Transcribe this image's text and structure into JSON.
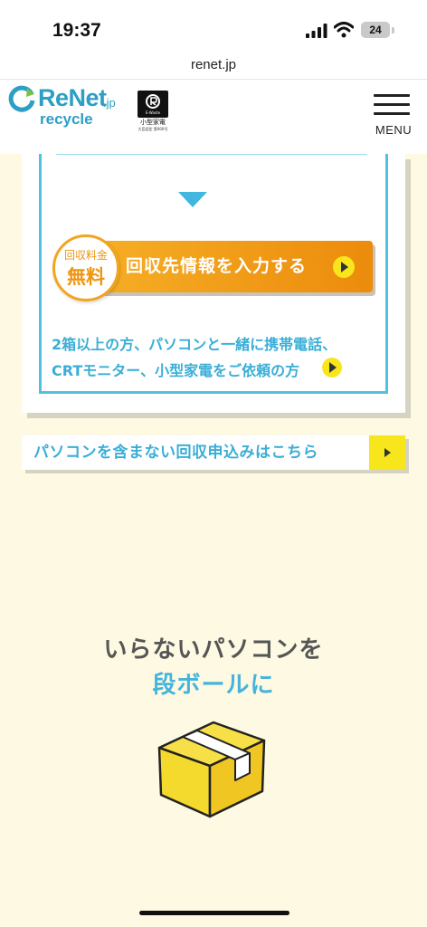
{
  "status_bar": {
    "time": "19:37",
    "battery": "24"
  },
  "browser": {
    "url": "renet.jp"
  },
  "header": {
    "logo_name": "ReNet",
    "logo_suffix": ".jp",
    "logo_sub": "recycle",
    "badge_label": "小型家電",
    "badge_tag": "E-Waste",
    "badge_small": "大臣認定 第000号",
    "menu_label": "MENU"
  },
  "card": {
    "free_badge_small": "回収料金",
    "free_badge_big": "無料",
    "cta_label": "回収先情報を入力する",
    "note_line1": "2箱以上の方、パソコンと一緒に携帯電話、",
    "note_line2": "CRTモニター、小型家電をご依頼の方"
  },
  "secondary_link": {
    "label": "パソコンを含まない回収申込みはこちら"
  },
  "section": {
    "headline_line1": "いらないパソコンを",
    "headline_line2": "段ボールに"
  },
  "colors": {
    "accent": "#3aaed6",
    "cta_start": "#f6b127",
    "cta_end": "#ec8b0c",
    "highlight": "#f7e61c",
    "background": "#fdf9e2"
  },
  "icons": [
    "signal-icon",
    "wifi-icon",
    "battery-icon",
    "renet-logo-icon",
    "e-waste-badge-icon",
    "hamburger-menu-icon",
    "down-triangle-icon",
    "arrow-right-icon",
    "cardboard-box-icon"
  ]
}
